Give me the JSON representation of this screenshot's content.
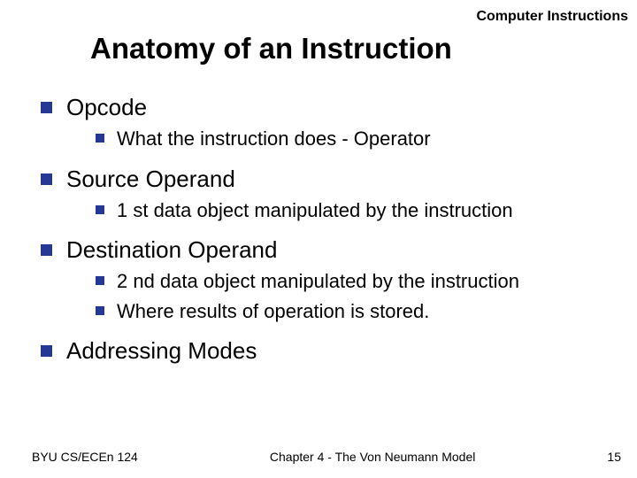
{
  "header_label": "Computer Instructions",
  "title": "Anatomy of an Instruction",
  "items": [
    {
      "label": "Opcode",
      "sub": [
        "What the instruction does - Operator"
      ]
    },
    {
      "label": "Source Operand",
      "sub": [
        "1 st data object manipulated by the instruction"
      ]
    },
    {
      "label": "Destination Operand",
      "sub": [
        "2 nd data object manipulated by the instruction",
        "Where results of operation is stored."
      ]
    },
    {
      "label": "Addressing Modes",
      "sub": []
    }
  ],
  "footer": {
    "left": "BYU CS/ECEn 124",
    "center": "Chapter 4 - The Von Neumann Model",
    "right": "15"
  }
}
